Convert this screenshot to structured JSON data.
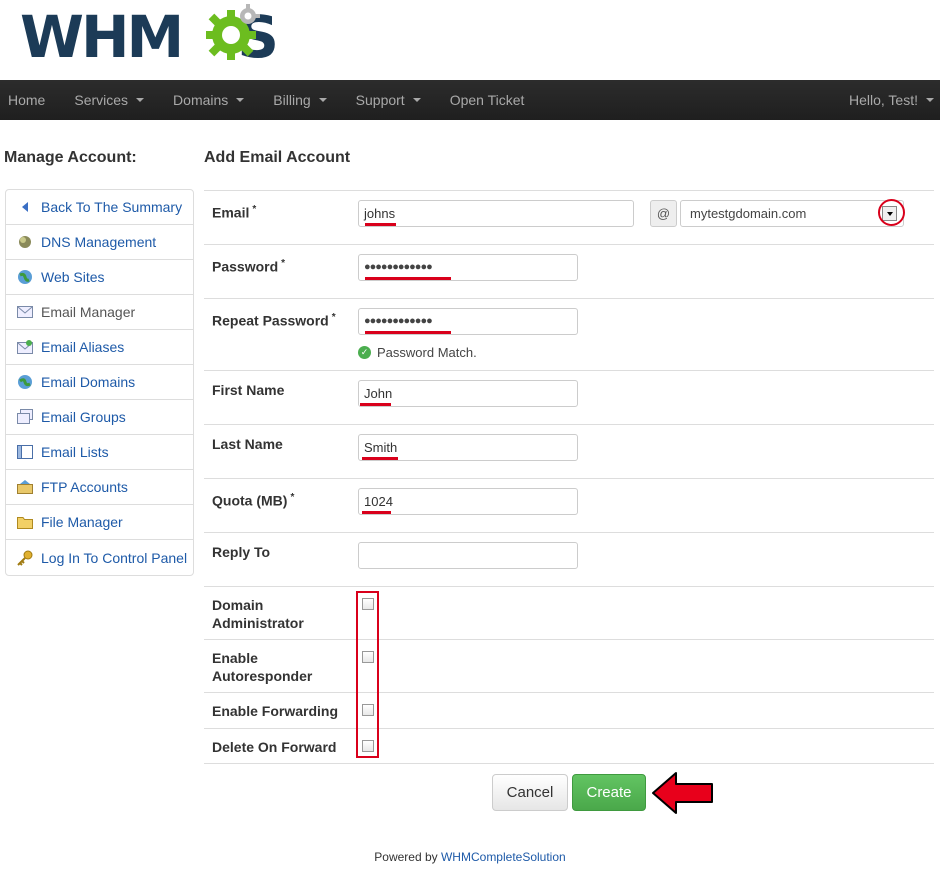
{
  "logo": {
    "text_before": "WHM",
    "text_after": "S"
  },
  "nav": {
    "items": [
      {
        "label": "Home",
        "caret": false
      },
      {
        "label": "Services",
        "caret": true
      },
      {
        "label": "Domains",
        "caret": true
      },
      {
        "label": "Billing",
        "caret": true
      },
      {
        "label": "Support",
        "caret": true
      },
      {
        "label": "Open Ticket",
        "caret": false
      }
    ],
    "user": "Hello, Test!"
  },
  "sidebar": {
    "title": "Manage Account:",
    "items": [
      {
        "label": "Back To The Summary",
        "icon": "back-arrow-icon"
      },
      {
        "label": "DNS Management",
        "icon": "dns-icon"
      },
      {
        "label": "Web Sites",
        "icon": "globe-icon"
      },
      {
        "label": "Email Manager",
        "icon": "envelope-icon"
      },
      {
        "label": "Email Aliases",
        "icon": "email-alias-icon"
      },
      {
        "label": "Email Domains",
        "icon": "email-domain-icon"
      },
      {
        "label": "Email Groups",
        "icon": "email-group-icon"
      },
      {
        "label": "Email Lists",
        "icon": "list-icon"
      },
      {
        "label": "FTP Accounts",
        "icon": "ftp-icon"
      },
      {
        "label": "File Manager",
        "icon": "folder-icon"
      },
      {
        "label": "Log In To Control Panel",
        "icon": "key-icon"
      }
    ]
  },
  "main": {
    "title": "Add Email Account",
    "email_label": "Email",
    "email_value": "johns",
    "at_symbol": "@",
    "domain_value": "mytestgdomain.com",
    "password_label": "Password",
    "password_value": "●●●●●●●●●●●●",
    "repeat_password_label": "Repeat Password",
    "repeat_password_value": "●●●●●●●●●●●●",
    "password_match": "Password Match.",
    "first_name_label": "First Name",
    "first_name_value": "John",
    "last_name_label": "Last Name",
    "last_name_value": "Smith",
    "quota_label": "Quota (MB)",
    "quota_value": "1024",
    "reply_to_label": "Reply To",
    "reply_to_value": "",
    "domain_admin_label_1": "Domain",
    "domain_admin_label_2": "Administrator",
    "autoresponder_label_1": "Enable",
    "autoresponder_label_2": "Autoresponder",
    "forwarding_label": "Enable Forwarding",
    "delete_on_forward_label": "Delete On Forward",
    "required_mark": "*"
  },
  "buttons": {
    "cancel": "Cancel",
    "create": "Create"
  },
  "footer": {
    "prefix": "Powered by ",
    "link": "WHMCompleteSolution"
  },
  "colors": {
    "navbar": "#222222",
    "link": "#1e5aa8",
    "annotation_red": "#d9001b",
    "create_green": "#5cb85c",
    "logo_blue": "#1c3b57",
    "logo_green": "#6cbd1f"
  }
}
